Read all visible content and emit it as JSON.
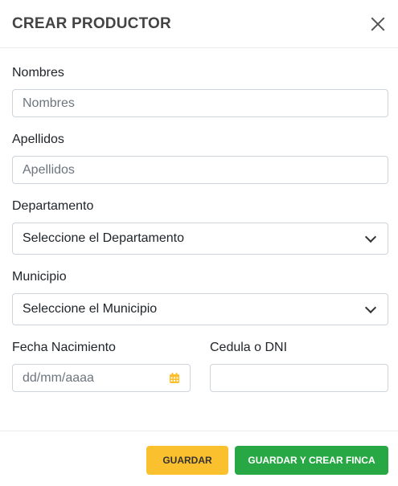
{
  "header": {
    "title": "CREAR PRODUCTOR"
  },
  "form": {
    "nombres": {
      "label": "Nombres",
      "placeholder": "Nombres",
      "value": ""
    },
    "apellidos": {
      "label": "Apellidos",
      "placeholder": "Apellidos",
      "value": ""
    },
    "departamento": {
      "label": "Departamento",
      "selected": "Seleccione el Departamento"
    },
    "municipio": {
      "label": "Municipio",
      "selected": "Seleccione el Municipio"
    },
    "fecha": {
      "label": "Fecha Nacimiento",
      "placeholder": "dd/mm/aaaa"
    },
    "cedula": {
      "label": "Cedula o DNI",
      "value": ""
    }
  },
  "footer": {
    "save_label": "GUARDAR",
    "save_farm_label": "GUARDAR Y CREAR FINCA"
  },
  "colors": {
    "save": "#fbc02d",
    "save_farm": "#28a745",
    "calendar_icon": "#fbc02d"
  }
}
